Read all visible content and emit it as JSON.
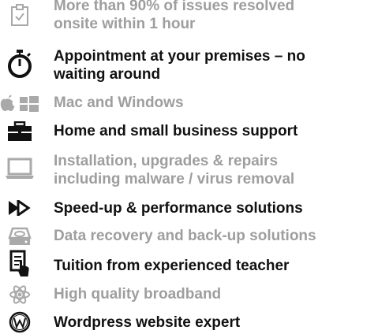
{
  "colors": {
    "dark_text": "#111111",
    "light_text": "#9e9e9e",
    "background": "#ffffff"
  },
  "features": [
    {
      "icon": "clipboard-check-icon",
      "tone": "light",
      "lines": [
        "More than 90% of issues resolved",
        "onsite within 1 hour"
      ]
    },
    {
      "icon": "stopwatch-icon",
      "tone": "dark",
      "lines": [
        "Appointment at your premises – no",
        "waiting around"
      ]
    },
    {
      "icon": "apple-windows-icon",
      "tone": "light",
      "lines": [
        "Mac and Windows"
      ]
    },
    {
      "icon": "briefcase-icon",
      "tone": "dark",
      "lines": [
        "Home and small business support"
      ]
    },
    {
      "icon": "laptop-icon",
      "tone": "light",
      "lines": [
        "Installation, upgrades & repairs",
        "including malware / virus removal"
      ]
    },
    {
      "icon": "fast-forward-icon",
      "tone": "dark",
      "lines": [
        "Speed-up & performance solutions"
      ]
    },
    {
      "icon": "hard-drive-icon",
      "tone": "light",
      "lines": [
        "Data recovery and back-up solutions"
      ]
    },
    {
      "icon": "document-hand-icon",
      "tone": "dark",
      "lines": [
        "Tuition from experienced teacher"
      ]
    },
    {
      "icon": "atom-icon",
      "tone": "light",
      "lines": [
        "High quality broadband"
      ]
    },
    {
      "icon": "wordpress-icon",
      "tone": "dark",
      "lines": [
        "Wordpress website expert"
      ]
    }
  ]
}
